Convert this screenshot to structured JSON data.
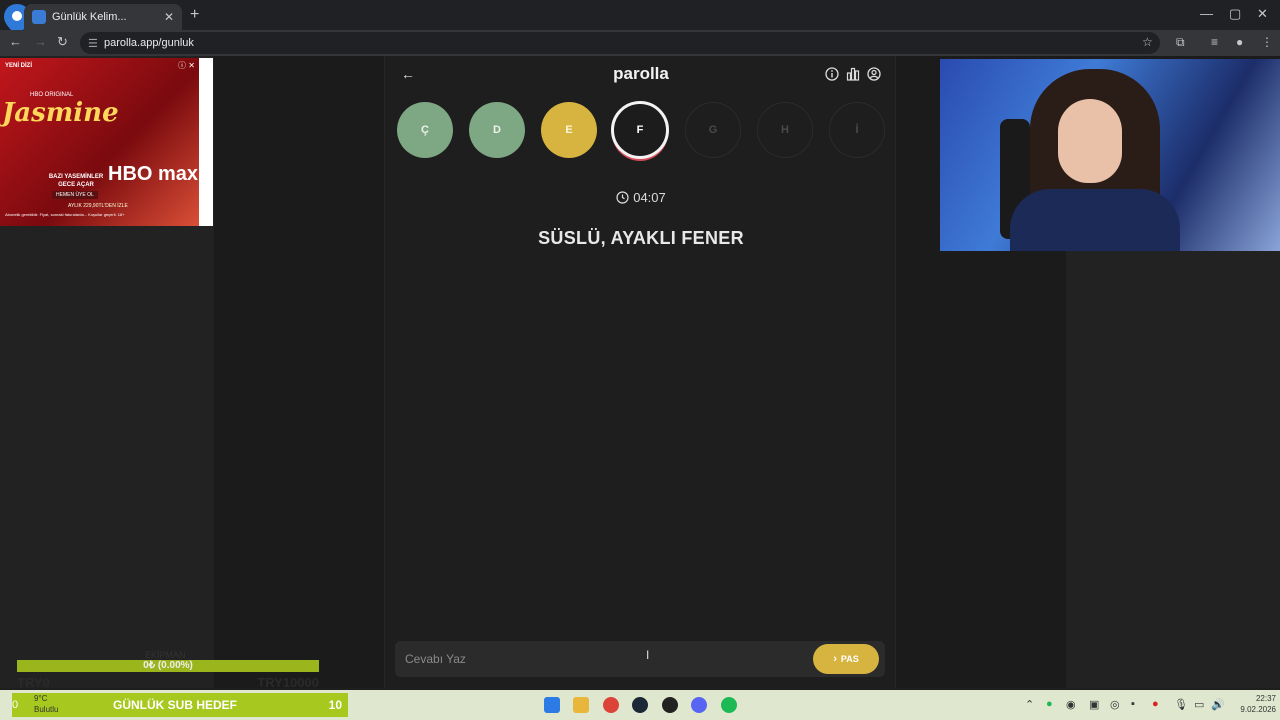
{
  "browser": {
    "tab_title": "Günlük Kelim...",
    "url": "parolla.app/gunluk",
    "window_controls": {
      "minimize": "—",
      "maximize": "▢",
      "close": "✕"
    }
  },
  "ad": {
    "tag": "YENİ DİZİ",
    "subtitle": "HBO ORIGINAL",
    "title": "Jasmine",
    "tagline": "BAZI YASEMİNLER GECE AÇAR",
    "brand": "HBO max",
    "cta": "HEMEN ÜYE OL",
    "price": "AYLIK 229,90TL'DEN İZLE",
    "legal": "Abonelik gereklidir. Fiyat, sonraki faturalarda... Koşullar geçerli. 18+"
  },
  "game": {
    "brand": "parolla",
    "letters": [
      {
        "letter": "Ç",
        "state": "correct"
      },
      {
        "letter": "D",
        "state": "correct"
      },
      {
        "letter": "E",
        "state": "passed"
      },
      {
        "letter": "F",
        "state": "active"
      },
      {
        "letter": "G",
        "state": "pending"
      },
      {
        "letter": "H",
        "state": "pending"
      },
      {
        "letter": "İ",
        "state": "pending"
      }
    ],
    "timer": "04:07",
    "question": "SÜSLÜ, AYAKLI FENER",
    "answer_placeholder": "Cevabı Yaz",
    "pass_label": "PAS",
    "colors": {
      "correct": "#7ea884",
      "passed": "#d7b43f",
      "active_ring": "#f3f3f3",
      "active_shadow": "#d94a5a"
    }
  },
  "overlay": {
    "team_label": "EKİPMAN",
    "progress_text": "0₺ (0.00%)",
    "progress_fraction": 0.0,
    "left_amount": "TRY0",
    "right_amount": "TRY10000",
    "sub_goal_label": "GÜNLÜK SUB HEDEF",
    "sub_goal_value": "10"
  },
  "taskbar": {
    "weather_count": "0",
    "temperature": "9°C",
    "condition": "Bulutlu",
    "time": "22:37",
    "date": "9.02.2026"
  }
}
